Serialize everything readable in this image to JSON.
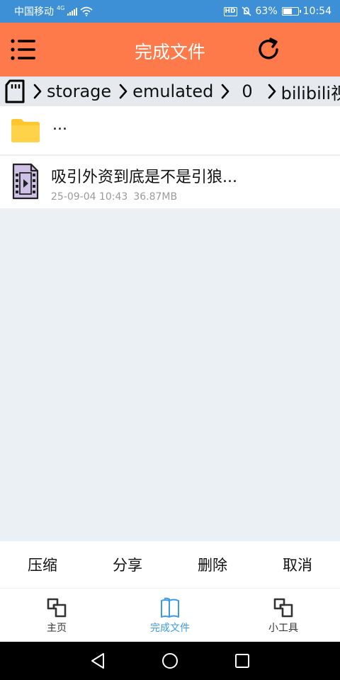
{
  "status_bar": {
    "carrier": "中国移动",
    "network": "4G",
    "battery": "63%",
    "battery_level": 0.63,
    "time": "10:54",
    "hd_label": "HD",
    "icons": [
      "signal-icon",
      "wifi-icon",
      "hd-icon",
      "mute-icon",
      "battery-icon"
    ]
  },
  "app_bar": {
    "title": "完成文件",
    "icons": [
      "menu-icon",
      "refresh-icon"
    ]
  },
  "path": {
    "icon": "sd-card-icon",
    "crumbs": [
      "storage",
      "emulated",
      "0",
      "bilibili视"
    ]
  },
  "files": {
    "parent": {
      "name": "...",
      "icon": "folder-icon",
      "color": "#ffc72c"
    },
    "items": [
      {
        "name": "吸引外资到底是不是引狼...",
        "date": "25-09-04 10:43",
        "size": "36.87MB",
        "icon": "video-file-icon"
      }
    ]
  },
  "actions": [
    "压缩",
    "分享",
    "删除",
    "取消"
  ],
  "tabs": [
    {
      "label": "主页",
      "icon": "home-squares-icon",
      "active": false
    },
    {
      "label": "完成文件",
      "icon": "book-icon",
      "active": true
    },
    {
      "label": "小工具",
      "icon": "tools-squares-icon",
      "active": false
    }
  ],
  "colors": {
    "status_bar": "#3d8fd6",
    "app_bar": "#ff7a4a",
    "active_tab": "#3c9be0",
    "background": "#ebf0f5"
  }
}
